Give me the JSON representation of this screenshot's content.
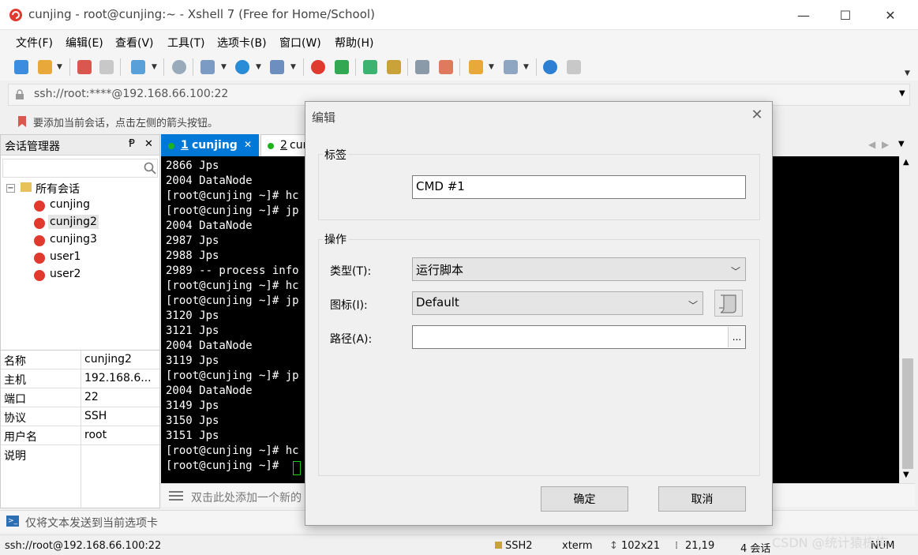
{
  "window": {
    "title": "cunjing - root@cunjing:~ - Xshell 7 (Free for Home/School)",
    "minimize_glyph": "—",
    "maximize_glyph": "☐",
    "close_glyph": "✕"
  },
  "menu": [
    "文件(F)",
    "编辑(E)",
    "查看(V)",
    "工具(T)",
    "选项卡(B)",
    "窗口(W)",
    "帮助(H)"
  ],
  "address_bar": {
    "value": "ssh://root:****@192.168.66.100:22"
  },
  "hint_bar": {
    "text": "要添加当前会话，点击左侧的箭头按钮。"
  },
  "session_manager": {
    "title": "会话管理器",
    "pin_glyph": "Ᵽ",
    "close_glyph": "✕",
    "search_icon": "search-icon",
    "root": "所有会话",
    "sessions": [
      "cunjing",
      "cunjing2",
      "cunjing3",
      "user1",
      "user2"
    ],
    "selected": "cunjing2",
    "properties": [
      {
        "key": "名称",
        "value": "cunjing2"
      },
      {
        "key": "主机",
        "value": "192.168.6..."
      },
      {
        "key": "端口",
        "value": "22"
      },
      {
        "key": "协议",
        "value": "SSH"
      },
      {
        "key": "用户名",
        "value": "root"
      },
      {
        "key": "说明",
        "value": ""
      }
    ]
  },
  "tabs": [
    {
      "num": "1",
      "label": "cunjing",
      "close": "✕",
      "active": true
    },
    {
      "num": "2",
      "label": "cur",
      "active": false
    }
  ],
  "terminal": {
    "lines": [
      "2866 Jps",
      "2004 DataNode",
      "[root@cunjing ~]# hc",
      "[root@cunjing ~]# jp",
      "2004 DataNode",
      "2987 Jps",
      "2988 Jps",
      "2989 -- process info",
      "[root@cunjing ~]# hc",
      "[root@cunjing ~]# jp",
      "3120 Jps",
      "3121 Jps",
      "2004 DataNode",
      "3119 Jps",
      "[root@cunjing ~]# jp",
      "2004 DataNode",
      "3149 Jps",
      "3150 Jps",
      "3151 Jps",
      "[root@cunjing ~]# hc",
      "[root@cunjing ~]# "
    ]
  },
  "compose_bar": {
    "text": "双击此处添加一个新的"
  },
  "send_bar": {
    "text": "仅将文本发送到当前选项卡"
  },
  "status_bar": {
    "connection": "ssh://root@192.168.66.100:22",
    "protocol": "SSH2",
    "term": "xterm",
    "size": "102x21",
    "cursor": "21,19",
    "sessions": "4 会话",
    "num": "NUM",
    "watermark": "CSDN @统计猿栋栋"
  },
  "dialog": {
    "title": "编辑",
    "close_glyph": "✕",
    "group_label": "标签",
    "label_value": "CMD #1",
    "action_group": "操作",
    "type_label": "类型(T):",
    "type_value": "运行脚本",
    "icon_label": "图标(I):",
    "icon_value": "Default",
    "path_label": "路径(A):",
    "path_value": "",
    "browse": "...",
    "ok": "确定",
    "cancel": "取消"
  },
  "colors": {
    "accent": "#0078d7",
    "terminal_bg": "#000000",
    "session_icon": "#e03a2e",
    "tab_dot": "#1db31d"
  }
}
